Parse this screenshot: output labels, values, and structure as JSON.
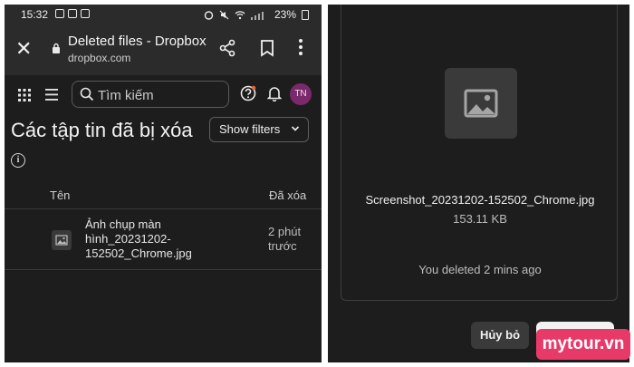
{
  "statusbar": {
    "time": "15:32",
    "battery": "23%"
  },
  "browser": {
    "title": "Deleted files - Dropbox",
    "url": "dropbox.com"
  },
  "appbar": {
    "search_placeholder": "Tìm kiếm",
    "avatar_initials": "TN"
  },
  "page": {
    "title": "Các tập tin đã bị xóa",
    "filters_label": "Show filters",
    "info_glyph": "i"
  },
  "table": {
    "columns": [
      "Tên",
      "Đã xóa"
    ],
    "rows": [
      {
        "name": "Ảnh chụp màn hình_20231202-152502_Chrome.jpg",
        "deleted": "2 phút trước"
      }
    ]
  },
  "dialog": {
    "filename": "Screenshot_20231202-152502_Chrome.jpg",
    "size": "153.11 KB",
    "deleted_text": "You deleted 2 mins ago",
    "cancel_label": "Hủy bỏ"
  },
  "watermark": {
    "text": "mytour.vn"
  },
  "colors": {
    "dark_bg": "#1d1d1d",
    "bar_bg": "#2b2b2b",
    "avatar": "#7a2a6a",
    "watermark": "#e73a69",
    "notification_dot": "#e8643c"
  }
}
